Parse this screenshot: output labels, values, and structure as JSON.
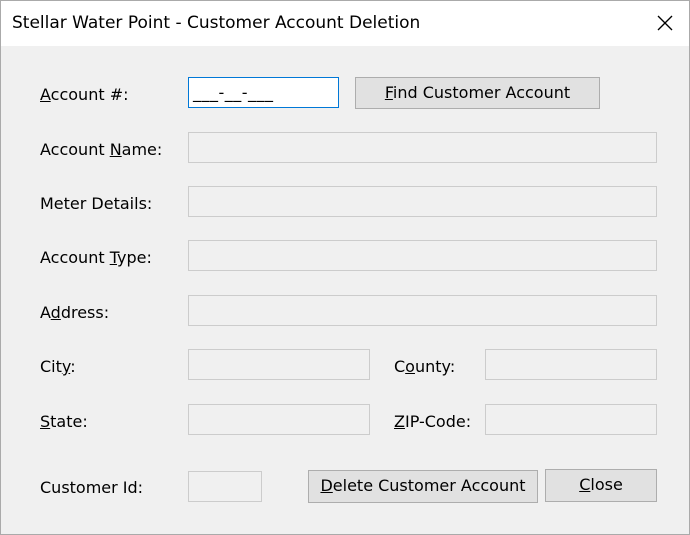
{
  "window": {
    "title": "Stellar Water Point - Customer Account Deletion",
    "close_icon": "close-icon"
  },
  "form": {
    "account_number": {
      "label_pre": "",
      "label_mnemonic": "A",
      "label_post": "ccount #:",
      "mask": "___-__-___"
    },
    "find_button": {
      "pre": "",
      "mnemonic": "F",
      "post": "ind Customer Account"
    },
    "account_name": {
      "label_pre": "Account ",
      "label_mnemonic": "N",
      "label_post": "ame:",
      "value": ""
    },
    "meter_details": {
      "label": "Meter Details:",
      "value": ""
    },
    "account_type": {
      "label_pre": "Account ",
      "label_mnemonic": "T",
      "label_post": "ype:",
      "value": ""
    },
    "address": {
      "label_pre": "A",
      "label_mnemonic": "d",
      "label_post": "dress:",
      "value": ""
    },
    "city": {
      "label_pre": "Cit",
      "label_mnemonic": "y",
      "label_post": ":",
      "value": ""
    },
    "county": {
      "label_pre": "C",
      "label_mnemonic": "o",
      "label_post": "unty:",
      "value": ""
    },
    "state": {
      "label_pre": "",
      "label_mnemonic": "S",
      "label_post": "tate:",
      "value": ""
    },
    "zip_code": {
      "label_pre": "",
      "label_mnemonic": "Z",
      "label_post": "IP-Code:",
      "value": ""
    },
    "customer_id": {
      "label": "Customer Id:",
      "value": ""
    }
  },
  "buttons": {
    "delete": {
      "pre": "",
      "mnemonic": "D",
      "post": "elete Customer Account"
    },
    "close": {
      "pre": "",
      "mnemonic": "C",
      "post": "lose"
    }
  }
}
